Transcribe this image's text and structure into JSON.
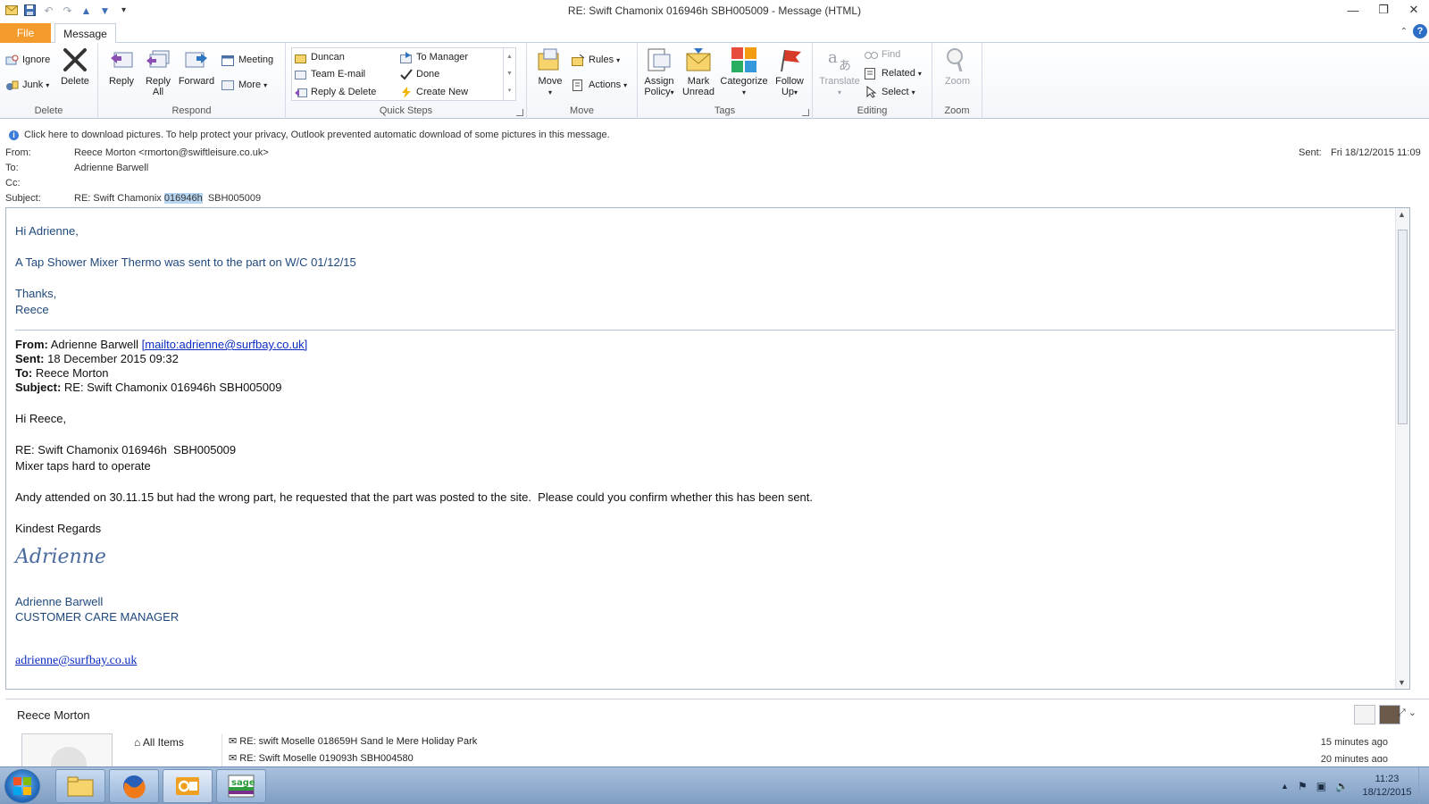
{
  "window": {
    "title": "RE: Swift Chamonix 016946h  SBH005009  -  Message (HTML)"
  },
  "tabs": {
    "file": "File",
    "message": "Message"
  },
  "ribbon": {
    "delete": {
      "ignore": "Ignore",
      "junk": "Junk",
      "delete": "Delete",
      "label": "Delete"
    },
    "respond": {
      "reply": "Reply",
      "reply_all_1": "Reply",
      "reply_all_2": "All",
      "forward": "Forward",
      "meeting": "Meeting",
      "more": "More",
      "label": "Respond"
    },
    "quick_steps": {
      "items": [
        "Duncan",
        "Team E-mail",
        "Reply & Delete",
        "To Manager",
        "Done",
        "Create New"
      ],
      "label": "Quick Steps"
    },
    "move": {
      "move": "Move",
      "rules": "Rules",
      "actions": "Actions",
      "label": "Move"
    },
    "tags": {
      "assign_policy_1": "Assign",
      "assign_policy_2": "Policy",
      "mark_unread_1": "Mark",
      "mark_unread_2": "Unread",
      "categorize": "Categorize",
      "follow_up_1": "Follow",
      "follow_up_2": "Up",
      "label": "Tags"
    },
    "editing": {
      "translate": "Translate",
      "find": "Find",
      "related": "Related",
      "select": "Select",
      "label": "Editing"
    },
    "zoom": {
      "zoom": "Zoom",
      "label": "Zoom"
    }
  },
  "infobar": {
    "text": "Click here to download pictures. To help protect your privacy, Outlook prevented automatic download of some pictures in this message."
  },
  "header": {
    "from_label": "From:",
    "from_value": "Reece Morton <rmorton@swiftleisure.co.uk>",
    "to_label": "To:",
    "to_value": "Adrienne Barwell",
    "cc_label": "Cc:",
    "subject_label": "Subject:",
    "subject_pre": "RE: Swift Chamonix ",
    "subject_hl": "016946h",
    "subject_post": "  SBH005009",
    "sent_label": "Sent:",
    "sent_value": "Fri 18/12/2015 11:09"
  },
  "body": {
    "greeting": "Hi Adrienne,",
    "line1": "A Tap Shower Mixer Thermo was sent to the part on W/C 01/12/15",
    "thanks": "Thanks,",
    "signoff": "Reece",
    "quoted": {
      "from_label": "From:",
      "from_name": "Adrienne Barwell ",
      "from_link": "[mailto:adrienne@surfbay.co.uk]",
      "sent_label": "Sent:",
      "sent_value": "18 December 2015 09:32",
      "to_label": "To:",
      "to_value": "Reece Morton",
      "subject_label": "Subject:",
      "subject_value": "RE: Swift Chamonix 016946h SBH005009",
      "greeting": "Hi Reece,",
      "ref": "RE: Swift Chamonix 016946h  SBH005009",
      "issue": "Mixer taps hard to operate",
      "para": "Andy attended on 30.11.15 but had the wrong part, he requested that the part was posted to the site.  Please could you confirm whether this has been sent.",
      "regards": "Kindest Regards",
      "signature": "Adrienne",
      "sig_name": "Adrienne Barwell",
      "sig_title": "CUSTOMER CARE MANAGER",
      "email": "adrienne@surfbay.co.uk"
    }
  },
  "people_pane": {
    "name": "Reece Morton",
    "all_items": "All Items",
    "items": [
      {
        "subject": "RE: swift Moselle 018659H Sand le Mere Holiday Park",
        "time": "15 minutes ago"
      },
      {
        "subject": "RE: Swift Moselle 019093h SBH004580",
        "time": "20 minutes ago"
      }
    ]
  },
  "taskbar": {
    "time": "11:23",
    "date": "18/12/2015"
  },
  "colors": {
    "file_tab": "#f39c2d",
    "body_text": "#1f497d",
    "link": "#0b2cc1"
  }
}
